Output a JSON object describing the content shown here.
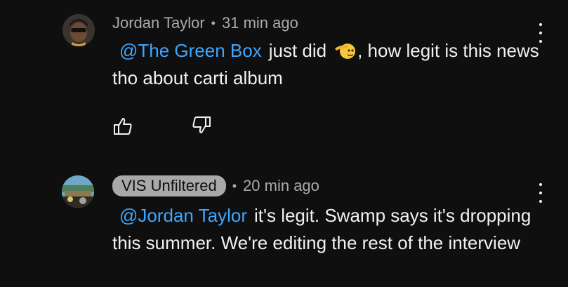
{
  "comments": [
    {
      "author": "Jordan Taylor",
      "time": "31 min ago",
      "mention": "@The Green Box",
      "text_part1": "just did",
      "text_part2": ", how legit is this news tho about carti album",
      "emoji": "saluting-face"
    },
    {
      "author": "VIS Unfiltered",
      "time": "20 min ago",
      "mention": "@Jordan Taylor",
      "text": "it's legit. Swamp says it's dropping this summer. We're editing the rest of the interview"
    }
  ],
  "colors": {
    "background": "#0f0f0f",
    "text": "#f1f1f1",
    "meta": "#aaaaaa",
    "mention": "#3ea6ff",
    "pill": "#a9a9a9"
  },
  "icons": [
    "like-icon",
    "dislike-icon",
    "more-options-icon",
    "avatar"
  ]
}
